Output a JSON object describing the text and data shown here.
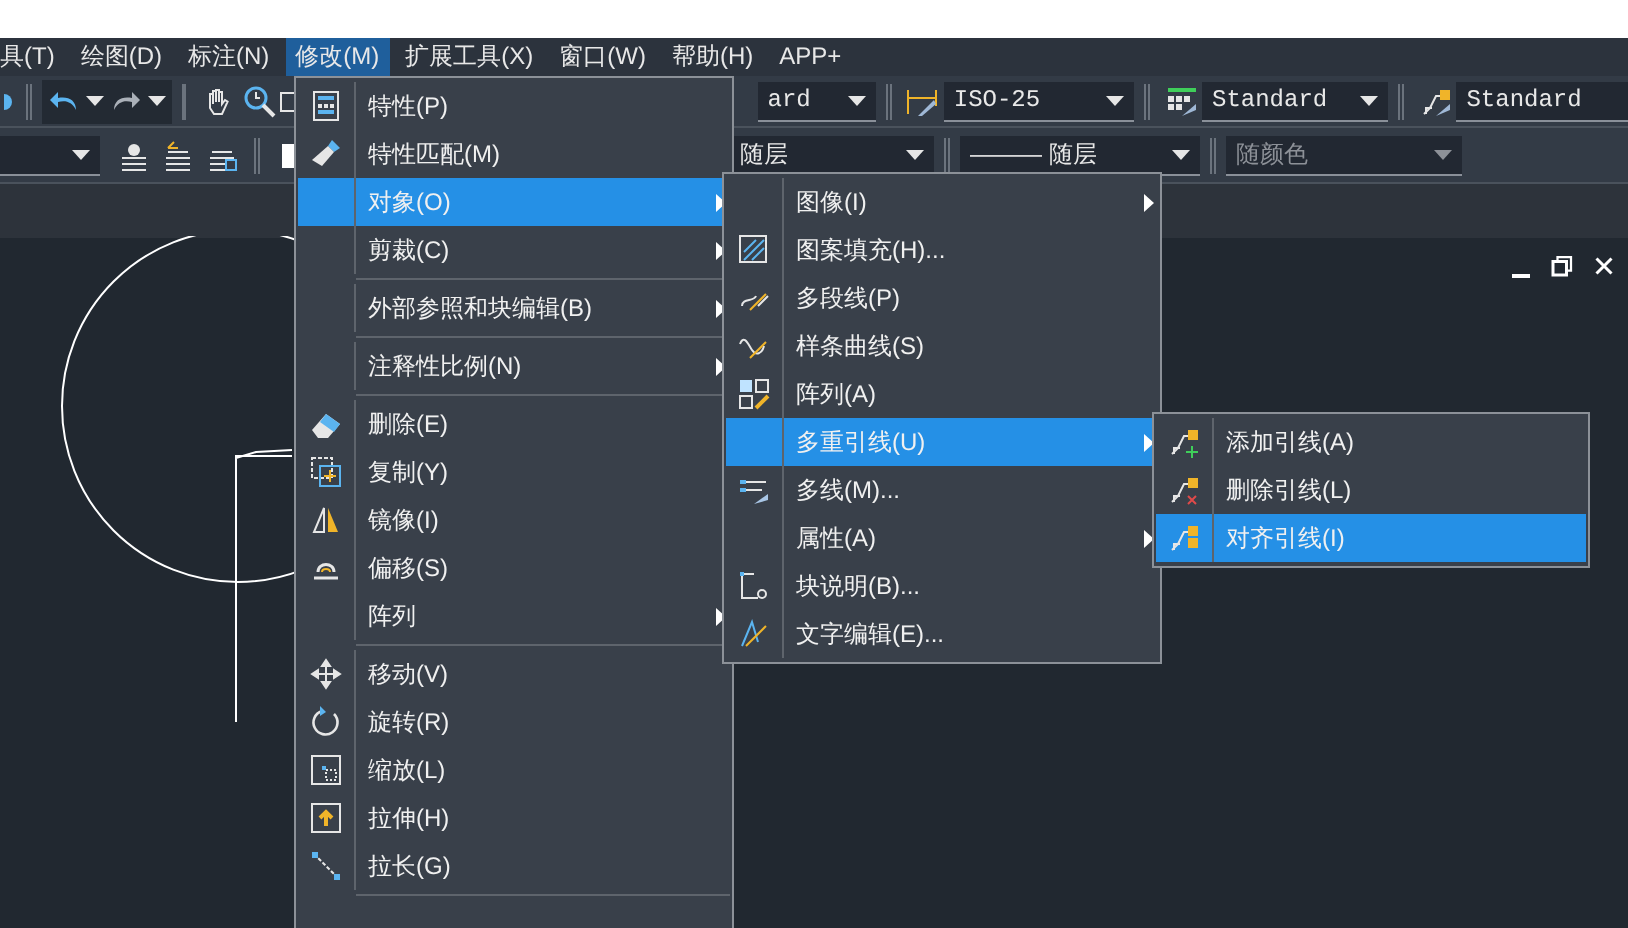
{
  "menubar": [
    {
      "label": "具(T)",
      "selected": false
    },
    {
      "label": "绘图(D)",
      "selected": false
    },
    {
      "label": "标注(N)",
      "selected": false
    },
    {
      "label": "修改(M)",
      "selected": true
    },
    {
      "label": "扩展工具(X)",
      "selected": false
    },
    {
      "label": "窗口(W)",
      "selected": false
    },
    {
      "label": "帮助(H)",
      "selected": false
    },
    {
      "label": "APP+",
      "selected": false
    }
  ],
  "toolbar_1": {
    "text_style_combo": "ard",
    "dim_style_combo": "ISO-25",
    "table_style_combo": "Standard",
    "multileader_style_combo": "Standard"
  },
  "toolbar_2": {
    "lineweight_combo": {
      "value": "随层",
      "disabled": false
    },
    "linetype_combo": {
      "value": "——— 随层",
      "disabled": false
    },
    "color_combo": {
      "value": "随颜色",
      "disabled": true
    }
  },
  "modify_menu": [
    {
      "kind": "command",
      "label": "特性(P)",
      "selected": false
    },
    {
      "kind": "command",
      "label": "特性匹配(M)",
      "selected": false
    },
    {
      "kind": "submenu",
      "label": "对象(O)",
      "selected": true
    },
    {
      "kind": "submenu",
      "label": "剪裁(C)",
      "selected": false
    },
    {
      "kind": "separator"
    },
    {
      "kind": "submenu",
      "label": "外部参照和块编辑(B)",
      "selected": false
    },
    {
      "kind": "separator"
    },
    {
      "kind": "submenu",
      "label": "注释性比例(N)",
      "selected": false
    },
    {
      "kind": "separator"
    },
    {
      "kind": "command",
      "label": "删除(E)",
      "selected": false
    },
    {
      "kind": "command",
      "label": "复制(Y)",
      "selected": false
    },
    {
      "kind": "command",
      "label": "镜像(I)",
      "selected": false
    },
    {
      "kind": "command",
      "label": "偏移(S)",
      "selected": false
    },
    {
      "kind": "submenu",
      "label": "阵列",
      "selected": false
    },
    {
      "kind": "separator"
    },
    {
      "kind": "command",
      "label": "移动(V)",
      "selected": false
    },
    {
      "kind": "command",
      "label": "旋转(R)",
      "selected": false
    },
    {
      "kind": "command",
      "label": "缩放(L)",
      "selected": false
    },
    {
      "kind": "command",
      "label": "拉伸(H)",
      "selected": false
    },
    {
      "kind": "command",
      "label": "拉长(G)",
      "selected": false
    },
    {
      "kind": "separator"
    }
  ],
  "object_submenu": [
    {
      "kind": "submenu",
      "label": "图像(I)",
      "selected": false
    },
    {
      "kind": "command",
      "label": "图案填充(H)...",
      "selected": false
    },
    {
      "kind": "command",
      "label": "多段线(P)",
      "selected": false
    },
    {
      "kind": "command",
      "label": "样条曲线(S)",
      "selected": false
    },
    {
      "kind": "command",
      "label": "阵列(A)",
      "selected": false
    },
    {
      "kind": "submenu",
      "label": "多重引线(U)",
      "selected": true
    },
    {
      "kind": "command",
      "label": "多线(M)...",
      "selected": false
    },
    {
      "kind": "submenu",
      "label": "属性(A)",
      "selected": false
    },
    {
      "kind": "command",
      "label": "块说明(B)...",
      "selected": false
    },
    {
      "kind": "command",
      "label": "文字编辑(E)...",
      "selected": false
    }
  ],
  "multileader_submenu": [
    {
      "kind": "command",
      "label": "添加引线(A)",
      "selected": false
    },
    {
      "kind": "command",
      "label": "删除引线(L)",
      "selected": false
    },
    {
      "kind": "command",
      "label": "对齐引线(I)",
      "selected": true
    }
  ]
}
